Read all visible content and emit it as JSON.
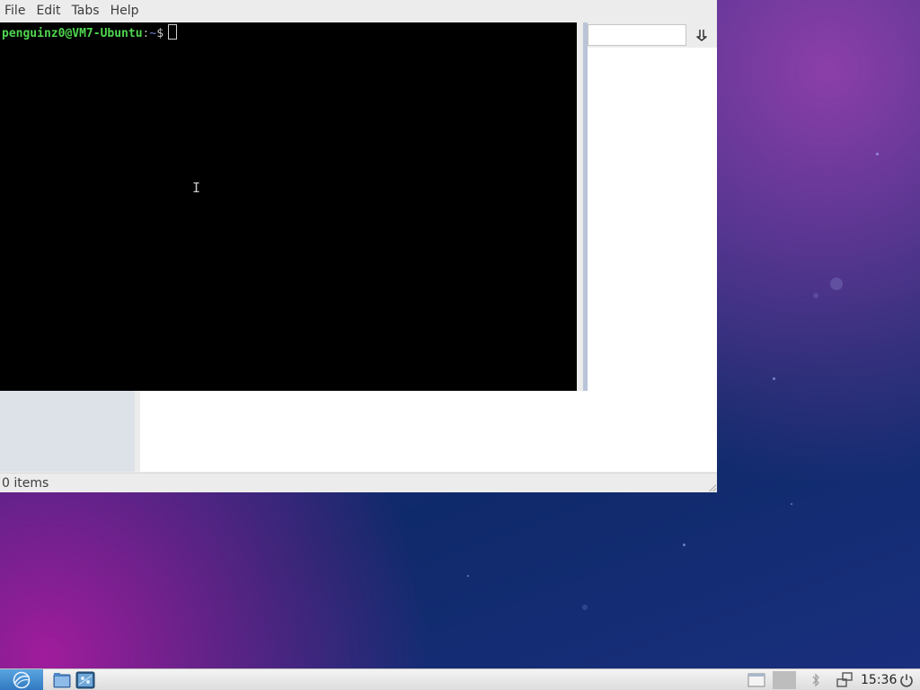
{
  "menubar": {
    "items": [
      {
        "label": "File"
      },
      {
        "label": "Edit"
      },
      {
        "label": "Tabs"
      },
      {
        "label": "Help"
      }
    ]
  },
  "terminal": {
    "user_host": "penguinz0@VM7-Ubuntu",
    "separator": ":",
    "path": "~",
    "dollar": "$"
  },
  "right_panel": {
    "path_value": ""
  },
  "statusbar": {
    "text": "0 items"
  },
  "taskbar": {
    "clock": "15:36"
  },
  "colors": {
    "terminal_bg": "#000000",
    "prompt_user": "#4fd64f",
    "prompt_path": "#6f7fd0",
    "start_button": "#3a86cc",
    "taskbar_bg": "#e6e6e6"
  },
  "icons": {
    "start": "lubuntu-logo-icon",
    "file_manager": "folder-icon",
    "terminal": "terminal-icon",
    "go": "down-arrow-icon",
    "bluetooth": "bluetooth-icon",
    "network": "network-icon",
    "power": "power-icon"
  }
}
